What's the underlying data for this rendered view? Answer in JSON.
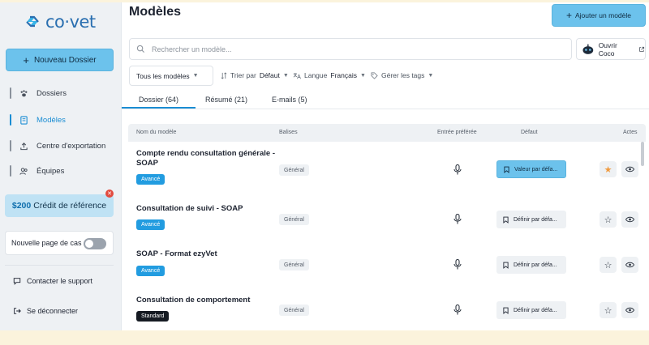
{
  "app": {
    "logo_text": "co·vet",
    "colors": {
      "accent": "#6cc2ec",
      "brand": "#2a6fb0",
      "active": "#1a8dd3",
      "badge_avance": "#229ce0",
      "badge_standard": "#151a22",
      "favorite_star": "#f09a3e"
    }
  },
  "sidebar": {
    "new_button": "Nouveau Dossier",
    "items": [
      {
        "label": "Dossiers",
        "icon": "paw-icon"
      },
      {
        "label": "Modèles",
        "icon": "document-icon"
      },
      {
        "label": "Centre d'exportation",
        "icon": "upload-icon"
      },
      {
        "label": "Équipes",
        "icon": "users-icon"
      }
    ],
    "referral": {
      "amount": "$200",
      "text": "Crédit de référence"
    },
    "toggle_label": "Nouvelle page de cas",
    "support": "Contacter le support",
    "logout": "Se déconnecter"
  },
  "header": {
    "title": "Modèles",
    "add_button": "Ajouter un modèle"
  },
  "search": {
    "placeholder": "Rechercher un modèle...",
    "coco_button": "Ouvrir Coco"
  },
  "filters": {
    "all_models": "Tous les modèles",
    "sort_label": "Trier par",
    "sort_value": "Défaut",
    "lang_label": "Langue",
    "lang_value": "Français",
    "tags": "Gérer les tags"
  },
  "tabs": [
    {
      "label": "Dossier (64)"
    },
    {
      "label": "Résumé (21)"
    },
    {
      "label": "E-mails (5)"
    }
  ],
  "table": {
    "headers": {
      "name": "Nom du modèle",
      "tags": "Balises",
      "input": "Entrée préférée",
      "default": "Défaut",
      "actions": "Actes"
    },
    "rows": [
      {
        "name": "Compte rendu consultation générale - SOAP",
        "badge": "Avancé",
        "tag": "Général",
        "default": "Valeur par défa...",
        "is_default": true,
        "favorite": true
      },
      {
        "name": "Consultation de suivi - SOAP",
        "badge": "Avancé",
        "tag": "Général",
        "default": "Définir par défa...",
        "is_default": false,
        "favorite": false
      },
      {
        "name": "SOAP - Format ezyVet",
        "badge": "Avancé",
        "tag": "Général",
        "default": "Définir par défa...",
        "is_default": false,
        "favorite": false
      },
      {
        "name": "Consultation de comportement",
        "badge": "Standard",
        "tag": "Général",
        "default": "Définir par défa...",
        "is_default": false,
        "favorite": false
      }
    ]
  }
}
